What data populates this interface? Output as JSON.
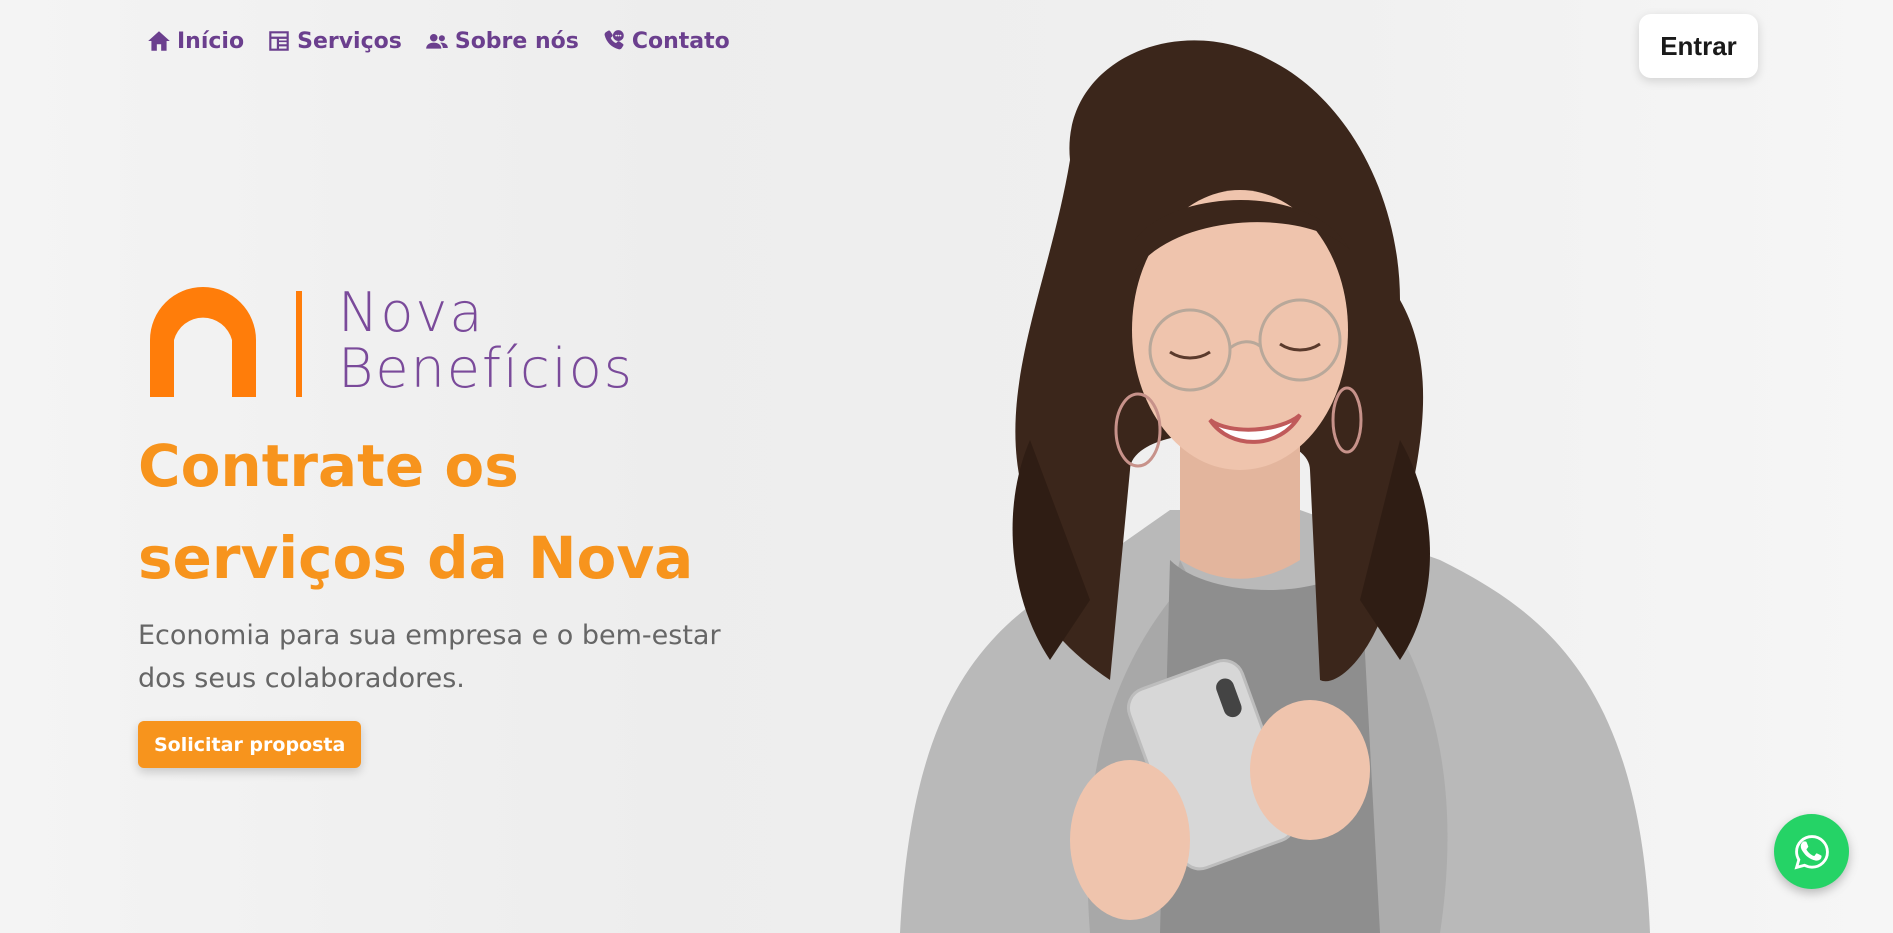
{
  "nav": {
    "items": [
      {
        "label": "Início",
        "icon": "home-icon"
      },
      {
        "label": "Serviços",
        "icon": "services-icon"
      },
      {
        "label": "Sobre nós",
        "icon": "people-icon"
      },
      {
        "label": "Contato",
        "icon": "phone-icon"
      }
    ],
    "login_label": "Entrar"
  },
  "logo": {
    "line1": "Nova",
    "line2": "Benefícios"
  },
  "hero": {
    "title_line1": "Contrate os",
    "title_line2": "serviços da Nova",
    "subtitle_line1": "Economia para sua empresa e o bem-estar",
    "subtitle_line2": "dos seus colaboradores.",
    "cta_label": "Solicitar proposta"
  },
  "floating": {
    "icon": "whatsapp-icon"
  },
  "colors": {
    "brand_orange": "#f7941d",
    "brand_purple": "#6b3f8e",
    "whatsapp_green": "#25d366"
  }
}
